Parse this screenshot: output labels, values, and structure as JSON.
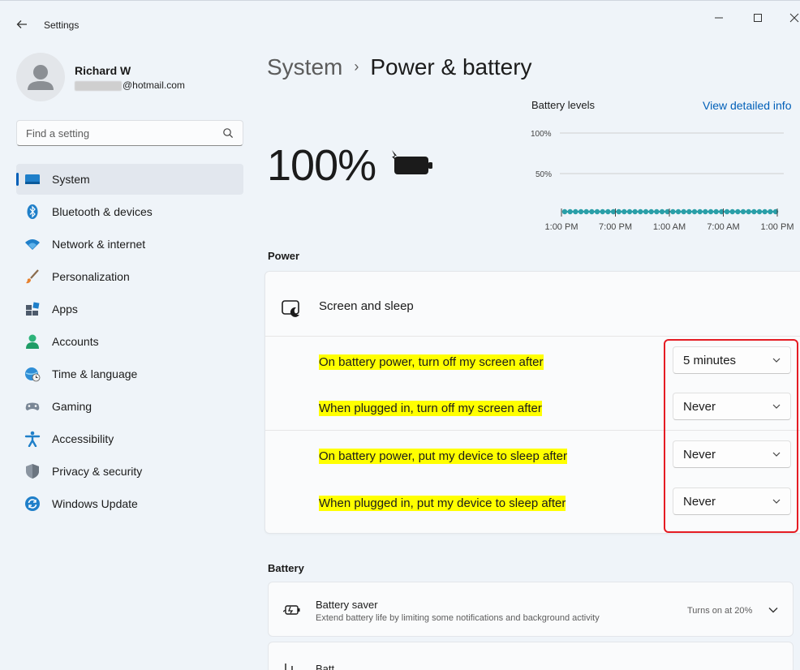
{
  "window": {
    "title": "Settings",
    "controls": [
      "minimize",
      "maximize",
      "close"
    ]
  },
  "profile": {
    "name": "Richard W",
    "email_domain": "@hotmail.com"
  },
  "search": {
    "placeholder": "Find a setting"
  },
  "sidebar": {
    "items": [
      {
        "label": "System",
        "icon": "system-icon",
        "active": true
      },
      {
        "label": "Bluetooth & devices",
        "icon": "bluetooth-icon"
      },
      {
        "label": "Network & internet",
        "icon": "wifi-icon"
      },
      {
        "label": "Personalization",
        "icon": "brush-icon"
      },
      {
        "label": "Apps",
        "icon": "apps-icon"
      },
      {
        "label": "Accounts",
        "icon": "person-icon"
      },
      {
        "label": "Time & language",
        "icon": "globe-clock-icon"
      },
      {
        "label": "Gaming",
        "icon": "gamepad-icon"
      },
      {
        "label": "Accessibility",
        "icon": "accessibility-icon"
      },
      {
        "label": "Privacy & security",
        "icon": "shield-icon"
      },
      {
        "label": "Windows Update",
        "icon": "update-icon"
      }
    ]
  },
  "breadcrumb": {
    "parent": "System",
    "separator": "›",
    "current": "Power & battery"
  },
  "battery": {
    "percent": "100%"
  },
  "battery_levels": {
    "title": "Battery levels",
    "link": "View detailed info",
    "y_ticks": [
      "100%",
      "50%"
    ],
    "x_ticks": [
      "1:00 PM",
      "7:00 PM",
      "1:00 AM",
      "7:00 AM",
      "1:00 PM"
    ],
    "dot_color": "#2a9fa8"
  },
  "power": {
    "section_label": "Power",
    "screen_sleep_title": "Screen and sleep",
    "rows": [
      {
        "label": "On battery power, turn off my screen after",
        "value": "5 minutes"
      },
      {
        "label": "When plugged in, turn off my screen after",
        "value": "Never"
      },
      {
        "label": "On battery power, put my device to sleep after",
        "value": "Never"
      },
      {
        "label": "When plugged in, put my device to sleep after",
        "value": "Never"
      }
    ]
  },
  "battery_section": {
    "label": "Battery",
    "saver": {
      "title": "Battery saver",
      "description": "Extend battery life by limiting some notifications and background activity",
      "status": "Turns on at 20%"
    },
    "next_title": "Batt"
  },
  "colors": {
    "accent": "#005fb8",
    "highlight": "#ffff00",
    "annotation_box": "#e51c23"
  }
}
